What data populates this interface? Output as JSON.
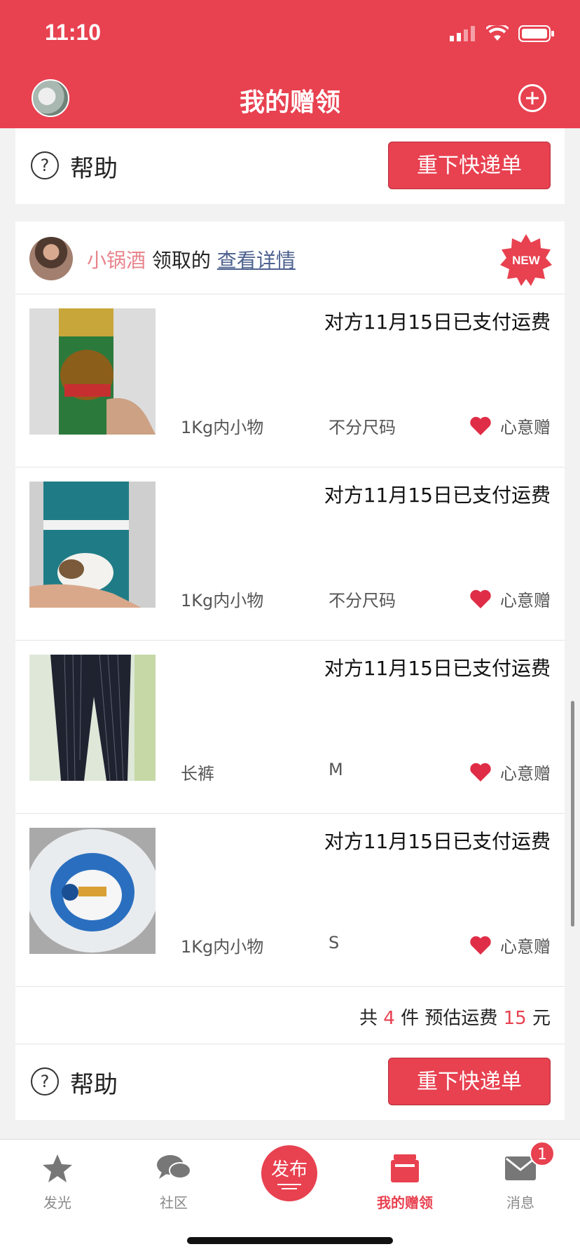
{
  "status": {
    "time": "11:10"
  },
  "header": {
    "title": "我的赠领"
  },
  "help": {
    "label": "帮助",
    "icon_text": "?",
    "reorder_button": "重下快递单"
  },
  "card": {
    "giver_name": "小锅酒",
    "claimed_label": "领取的",
    "details_link": "查看详情",
    "badge": "NEW",
    "items": [
      {
        "paid": "对方11月15日已支付运费",
        "category": "1Kg内小物",
        "size": "不分尺码",
        "gift": "心意赠"
      },
      {
        "paid": "对方11月15日已支付运费",
        "category": "1Kg内小物",
        "size": "不分尺码",
        "gift": "心意赠"
      },
      {
        "paid": "对方11月15日已支付运费",
        "category": "长裤",
        "size": "M",
        "gift": "心意赠"
      },
      {
        "paid": "对方11月15日已支付运费",
        "category": "1Kg内小物",
        "size": "S",
        "gift": "心意赠"
      }
    ],
    "summary": {
      "prefix": "共",
      "count": "4",
      "mid": "件 预估运费",
      "fee": "15",
      "suffix": "元"
    }
  },
  "tabs": [
    {
      "label": "发光",
      "icon": "star-icon"
    },
    {
      "label": "社区",
      "icon": "chat-icon"
    },
    {
      "label": "发布",
      "icon": "publish-icon"
    },
    {
      "label": "我的赠领",
      "icon": "gift-box-icon",
      "active": true
    },
    {
      "label": "消息",
      "icon": "mail-icon",
      "badge": "1"
    }
  ],
  "colors": {
    "brand": "#e84150",
    "link": "#4e628f",
    "name": "#e8848c"
  }
}
